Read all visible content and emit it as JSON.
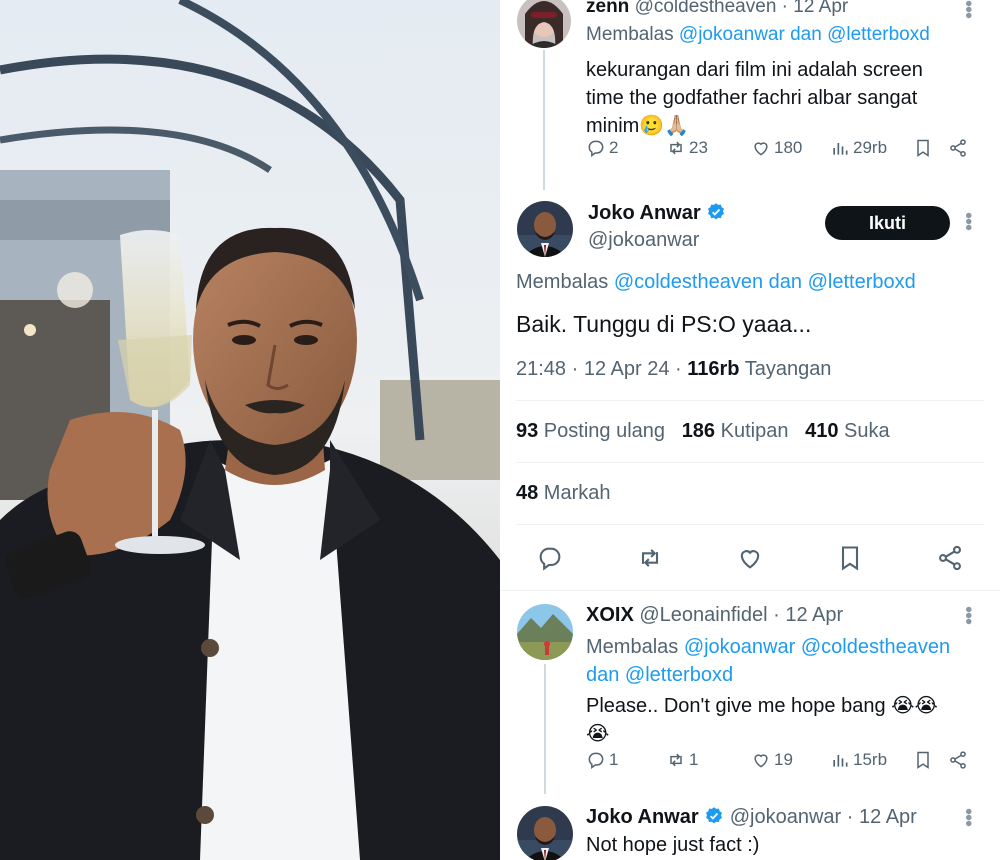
{
  "reply1": {
    "name": "zenn",
    "handle": "@coldestheaven",
    "date": "· 12 Apr",
    "reply_prefix": "Membalas ",
    "reply_to": "@jokoanwar dan @letterboxd",
    "text_line1": "kekurangan dari film ini adalah screen",
    "text_line2": "time the godfather fachri albar sangat",
    "text_line3": "minim🥲🙏🏼",
    "replies": "2",
    "reposts": "23",
    "likes": "180",
    "views": "29rb"
  },
  "main": {
    "name": "Joko Anwar",
    "handle": "@jokoanwar",
    "follow_label": "Ikuti",
    "reply_prefix": "Membalas ",
    "reply_to": "@coldestheaven dan @letterboxd",
    "text": "Baik. Tunggu di PS:O yaaa...",
    "time": "21:48 · 12 Apr 24 · ",
    "views_count": "116rb",
    "views_label": " Tayangan",
    "reposts_count": "93",
    "reposts_label": " Posting ulang",
    "quotes_count": "186",
    "quotes_label": " Kutipan",
    "likes_count": "410",
    "likes_label": " Suka",
    "bookmarks_count": "48",
    "bookmarks_label": " Markah"
  },
  "reply2": {
    "name": "XOIX",
    "handle": "@Leonainfidel",
    "date": "· 12 Apr",
    "reply_prefix": "Membalas ",
    "reply_to_line1": "@jokoanwar @coldestheaven",
    "reply_to_line2": "dan @letterboxd",
    "text_line1": "Please.. Don't give me hope bang 😭😭",
    "text_line2": "😭",
    "replies": "1",
    "reposts": "1",
    "likes": "19",
    "views": "15rb"
  },
  "reply3": {
    "name": "Joko Anwar",
    "handle": "@jokoanwar",
    "date": "· 12 Apr",
    "text": "Not hope just fact :)"
  },
  "colors": {
    "accent": "#1d9bf0",
    "text": "#0f1419",
    "muted": "#536471"
  },
  "icons": [
    "reply-icon",
    "repost-icon",
    "like-icon",
    "views-icon",
    "bookmark-icon",
    "share-icon",
    "verified-badge-icon",
    "more-icon"
  ]
}
